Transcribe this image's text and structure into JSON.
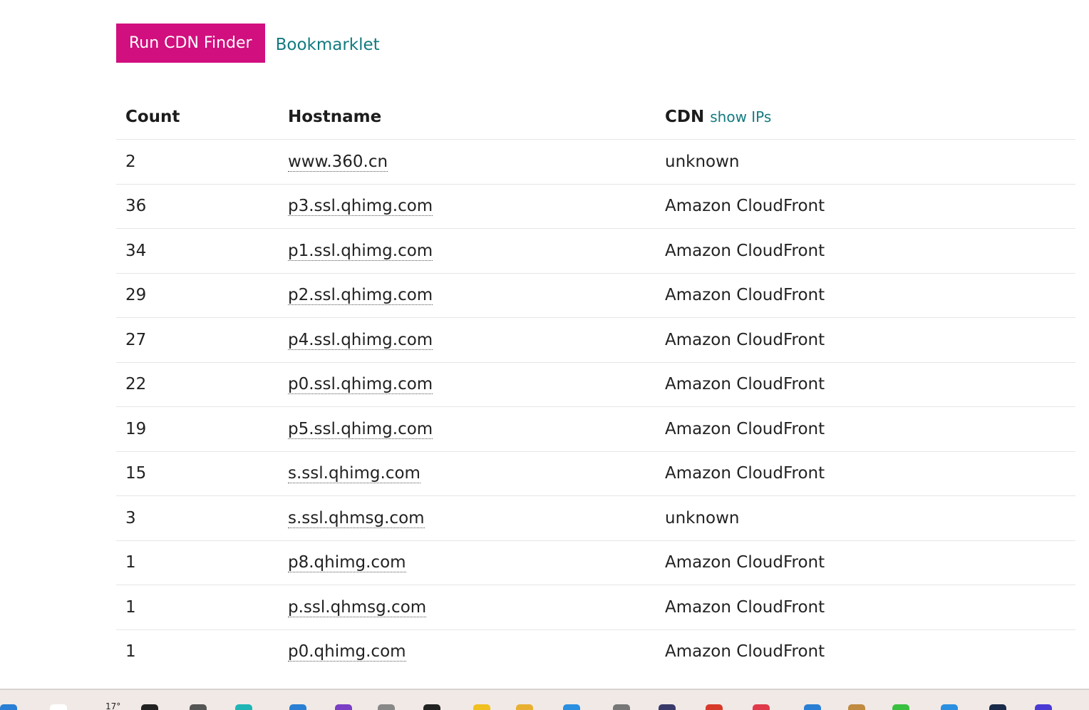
{
  "toolbar": {
    "run_label": "Run CDN Finder",
    "bookmarklet_label": "Bookmarklet"
  },
  "table": {
    "headers": {
      "count": "Count",
      "hostname": "Hostname",
      "cdn": "CDN",
      "show_ips": "show IPs"
    },
    "rows": [
      {
        "count": "2",
        "hostname": "www.360.cn",
        "cdn": "unknown"
      },
      {
        "count": "36",
        "hostname": "p3.ssl.qhimg.com",
        "cdn": "Amazon CloudFront"
      },
      {
        "count": "34",
        "hostname": "p1.ssl.qhimg.com",
        "cdn": "Amazon CloudFront"
      },
      {
        "count": "29",
        "hostname": "p2.ssl.qhimg.com",
        "cdn": "Amazon CloudFront"
      },
      {
        "count": "27",
        "hostname": "p4.ssl.qhimg.com",
        "cdn": "Amazon CloudFront"
      },
      {
        "count": "22",
        "hostname": "p0.ssl.qhimg.com",
        "cdn": "Amazon CloudFront"
      },
      {
        "count": "19",
        "hostname": "p5.ssl.qhimg.com",
        "cdn": "Amazon CloudFront"
      },
      {
        "count": "15",
        "hostname": "s.ssl.qhimg.com",
        "cdn": "Amazon CloudFront"
      },
      {
        "count": "3",
        "hostname": "s.ssl.qhmsg.com",
        "cdn": "unknown"
      },
      {
        "count": "1",
        "hostname": "p8.qhimg.com",
        "cdn": "Amazon CloudFront"
      },
      {
        "count": "1",
        "hostname": "p.ssl.qhmsg.com",
        "cdn": "Amazon CloudFront"
      },
      {
        "count": "1",
        "hostname": "p0.qhimg.com",
        "cdn": "Amazon CloudFront"
      }
    ]
  },
  "taskbar": {
    "weather_temp": "17°",
    "icons": [
      {
        "name": "start-icon",
        "color": "#2a7fd4"
      },
      {
        "name": "search-icon",
        "color": "#ffffff"
      },
      {
        "name": "weather-icon",
        "color": "#cccccc"
      },
      {
        "name": "epic-games-icon",
        "color": "#222222"
      },
      {
        "name": "app-icon",
        "color": "#555555"
      },
      {
        "name": "browser-icon",
        "color": "#1fb5b5"
      },
      {
        "name": "vscode-icon",
        "color": "#2a7fd4"
      },
      {
        "name": "visual-studio-icon",
        "color": "#7a3fc4"
      },
      {
        "name": "app-icon-2",
        "color": "#888888"
      },
      {
        "name": "github-icon",
        "color": "#222222"
      },
      {
        "name": "star-icon",
        "color": "#f0c020"
      },
      {
        "name": "folder-icon",
        "color": "#e8b030"
      },
      {
        "name": "mail-icon",
        "color": "#2a8fe0"
      },
      {
        "name": "app-icon-3",
        "color": "#777777"
      },
      {
        "name": "terminal-icon",
        "color": "#3a3a6a"
      },
      {
        "name": "chrome-icon",
        "color": "#d83a2a"
      },
      {
        "name": "app-icon-4",
        "color": "#e03a4a"
      },
      {
        "name": "app-icon-5",
        "color": "#2a7fd4"
      },
      {
        "name": "app-icon-6",
        "color": "#c08a40"
      },
      {
        "name": "app-icon-7",
        "color": "#3ac040"
      },
      {
        "name": "app-icon-8",
        "color": "#2a8fe0"
      },
      {
        "name": "app-icon-9",
        "color": "#1a2a4a"
      },
      {
        "name": "app-icon-10",
        "color": "#4a3ad4"
      }
    ]
  }
}
